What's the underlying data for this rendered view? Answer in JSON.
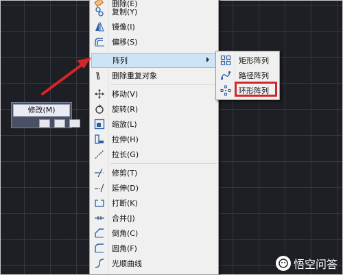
{
  "menu": {
    "items": [
      {
        "label": "删除(E)",
        "icon": "erase-icon"
      },
      {
        "label": "复制(Y)",
        "icon": "copy-icon"
      },
      {
        "label": "镜像(I)",
        "icon": "mirror-icon"
      },
      {
        "label": "偏移(S)",
        "icon": "offset-icon"
      },
      {
        "label": "阵列",
        "icon": "array-icon"
      },
      {
        "label": "删除重复对象",
        "icon": "delete-duplicates-icon"
      },
      {
        "label": "移动(V)",
        "icon": "move-icon"
      },
      {
        "label": "旋转(R)",
        "icon": "rotate-icon"
      },
      {
        "label": "缩放(L)",
        "icon": "scale-icon"
      },
      {
        "label": "拉伸(H)",
        "icon": "stretch-icon"
      },
      {
        "label": "拉长(G)",
        "icon": "lengthen-icon"
      },
      {
        "label": "修剪(T)",
        "icon": "trim-icon"
      },
      {
        "label": "延伸(D)",
        "icon": "extend-icon"
      },
      {
        "label": "打断(K)",
        "icon": "break-icon"
      },
      {
        "label": "合并(J)",
        "icon": "join-icon"
      },
      {
        "label": "倒角(C)",
        "icon": "chamfer-icon"
      },
      {
        "label": "圆角(F)",
        "icon": "fillet-icon"
      },
      {
        "label": "光顺曲线",
        "icon": "blend-curves-icon"
      }
    ]
  },
  "submenu": {
    "items": [
      {
        "label": "矩形阵列",
        "icon": "rectangular-array-icon"
      },
      {
        "label": "路径阵列",
        "icon": "path-array-icon"
      },
      {
        "label": "环形阵列",
        "icon": "polar-array-icon"
      }
    ]
  },
  "toolbar": {
    "title": "修改(M)"
  },
  "watermark": {
    "text": "悟空问答"
  },
  "colors": {
    "highlight": "#d62428",
    "canvas": "#1d1f24",
    "active_item": "#cde4f7"
  }
}
